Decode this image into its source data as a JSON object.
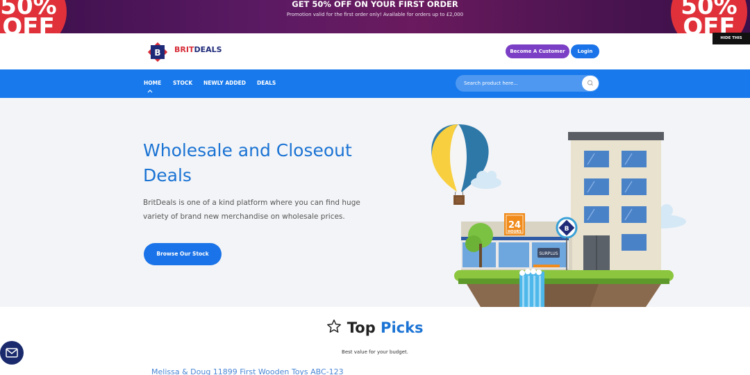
{
  "promo": {
    "badge_text": "50% OFF",
    "title": "GET 50% OFF ON YOUR FIRST ORDER",
    "subtitle": "Promotion valid for the first order only! Available for orders up to £2,000",
    "hide_label": "HIDE THIS"
  },
  "header": {
    "logo_letter": "B",
    "logo_brand_red": "BRIT",
    "logo_brand_blue": "DEALS",
    "become_customer": "Become A Customer",
    "login": "Login"
  },
  "nav": {
    "items": [
      "HOME",
      "STOCK",
      "NEWLY ADDED",
      "DEALS"
    ],
    "search_placeholder": "Search product here..."
  },
  "hero": {
    "title": "Wholesale and Closeout Deals",
    "description": "BritDeals is one of a kind platform where you can find huge variety of brand new merchandise on wholesale prices.",
    "button": "Browse Our Stock",
    "sign_24": "24",
    "sign_hours": "HOURS",
    "sign_surplus": "SURPLUS",
    "shop_badge": "B"
  },
  "top_picks": {
    "title_a": "Top",
    "title_b": "Picks",
    "subtitle": "Best value for your budget.",
    "first_product": "Melissa & Doug 11899 First Wooden Toys ABC-123"
  },
  "colors": {
    "primary": "#1a73e8",
    "nav": "#1779ec",
    "purple": "#7b3fc6",
    "promo_bg": "#5b1a63",
    "badge_red": "#e0313a",
    "navy": "#1e2a78"
  }
}
